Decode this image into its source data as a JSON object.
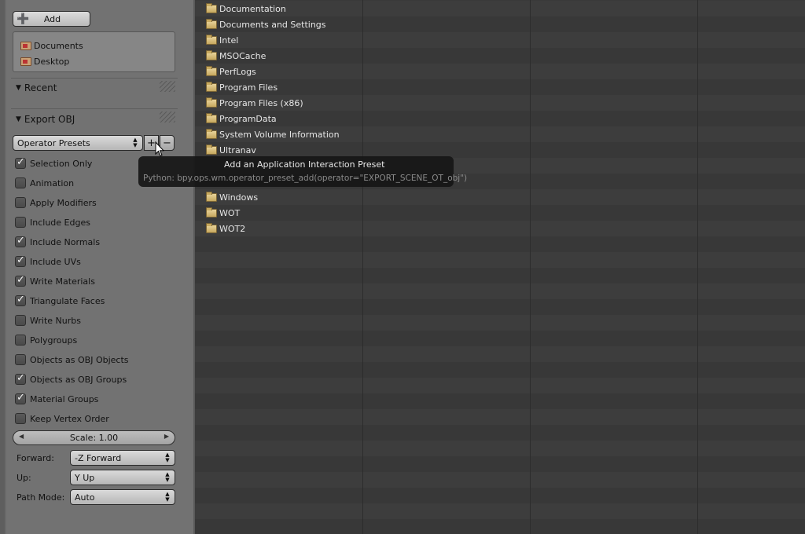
{
  "sidebar": {
    "add_label": "Add",
    "bookmarks": [
      "Documents",
      "Desktop"
    ],
    "recent_label": "Recent",
    "export_label": "Export OBJ",
    "presets_label": "Operator Presets",
    "options": [
      {
        "label": "Selection Only",
        "checked": true
      },
      {
        "label": "Animation",
        "checked": false
      },
      {
        "label": "Apply Modifiers",
        "checked": false
      },
      {
        "label": "Include Edges",
        "checked": false
      },
      {
        "label": "Include Normals",
        "checked": true
      },
      {
        "label": "Include UVs",
        "checked": true
      },
      {
        "label": "Write Materials",
        "checked": true
      },
      {
        "label": "Triangulate Faces",
        "checked": true
      },
      {
        "label": "Write Nurbs",
        "checked": false
      },
      {
        "label": "Polygroups",
        "checked": false
      },
      {
        "label": "Objects as OBJ Objects",
        "checked": false
      },
      {
        "label": "Objects as OBJ Groups",
        "checked": true
      },
      {
        "label": "Material Groups",
        "checked": true
      },
      {
        "label": "Keep Vertex Order",
        "checked": false
      }
    ],
    "scale_label": "Scale: 1.00",
    "forward": {
      "label": "Forward:",
      "value": "-Z Forward"
    },
    "up": {
      "label": "Up:",
      "value": "Y Up"
    },
    "path_mode": {
      "label": "Path Mode:",
      "value": "Auto"
    }
  },
  "files": [
    "Documentation",
    "Documents and Settings",
    "Intel",
    "MSOCache",
    "PerfLogs",
    "Program Files",
    "Program Files (x86)",
    "ProgramData",
    "System Volume Information",
    "Ultranav",
    "",
    "",
    "Windows",
    "WOT",
    "WOT2"
  ],
  "tooltip": {
    "title": "Add an Application Interaction Preset",
    "python": "Python: bpy.ops.wm.operator_preset_add(operator=\"EXPORT_SCENE_OT_obj\")"
  }
}
